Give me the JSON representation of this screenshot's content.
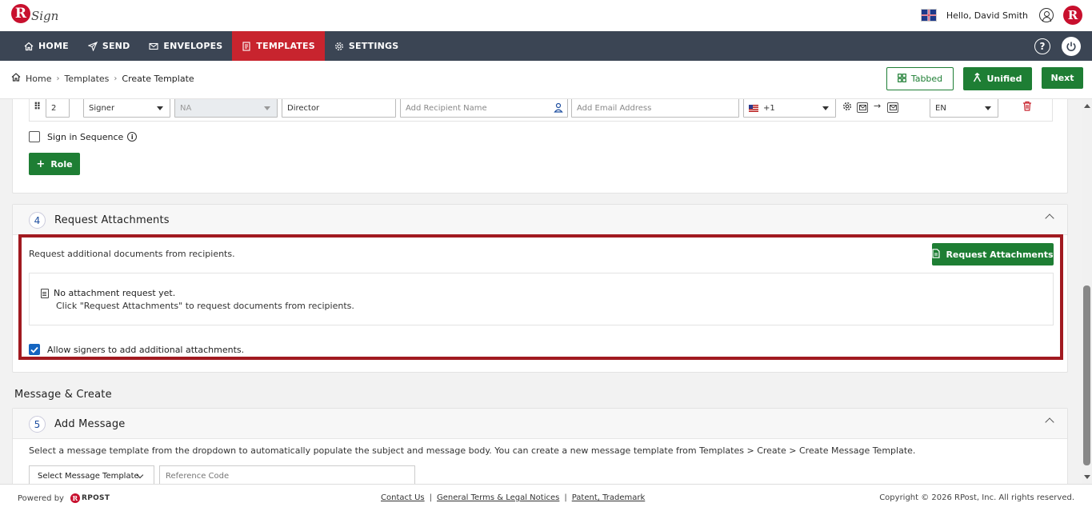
{
  "app": {
    "logo_letter": "R",
    "logo_text": "Sign",
    "greeting": "Hello, David Smith",
    "brand_letter": "R"
  },
  "nav": {
    "items": [
      {
        "label": "HOME",
        "icon": "home-icon"
      },
      {
        "label": "SEND",
        "icon": "send-icon"
      },
      {
        "label": "ENVELOPES",
        "icon": "envelope-icon"
      },
      {
        "label": "TEMPLATES",
        "icon": "template-icon",
        "active": true
      },
      {
        "label": "SETTINGS",
        "icon": "gear-icon"
      }
    ],
    "help_label": "?"
  },
  "breadcrumb": {
    "items": [
      "Home",
      "Templates",
      "Create Template"
    ],
    "separator": "›"
  },
  "toolbar": {
    "tabbed_label": "Tabbed",
    "unified_label": "Unified",
    "next_label": "Next"
  },
  "recipient_row": {
    "order": "2",
    "role_type": "Signer",
    "delegate": "NA",
    "role_name": "Director",
    "recipient_name_placeholder": "Add Recipient Name",
    "email_placeholder": "Add Email Address",
    "country_code": "+1",
    "language": "EN"
  },
  "roles": {
    "sequence_label": "Sign in Sequence",
    "add_role_label": "Role",
    "add_symbol": "+"
  },
  "attachments": {
    "step": "4",
    "title": "Request Attachments",
    "description": "Request additional documents from recipients.",
    "button_label": "Request Attachments",
    "empty_title": "No attachment request yet.",
    "empty_hint": "Click \"Request Attachments\" to request documents from recipients.",
    "allow_label": "Allow signers to add additional attachments.",
    "allow_checked": true
  },
  "message_section": {
    "heading": "Message & Create",
    "step": "5",
    "title": "Add Message",
    "description": "Select a message template from the dropdown to automatically populate the subject and message body. You can create a new message template from Templates > Create > Create Message Template.",
    "select_label": "Select Message Template",
    "reference_placeholder": "Reference Code"
  },
  "footer": {
    "powered_by": "Powered by",
    "rpost_letter": "R",
    "rpost_text": "RPOST",
    "links": [
      "Contact Us",
      "General Terms & Legal Notices",
      "Patent, Trademark"
    ],
    "link_separator": "|",
    "copyright": "Copyright © 2026 RPost, Inc. All rights reserved."
  },
  "colors": {
    "nav_bg": "#3b4554",
    "nav_active": "#c8242e",
    "primary_green": "#1e7e34",
    "brand_red": "#c8102e",
    "highlight_border": "#a11a20",
    "checkbox_blue": "#1565c0"
  }
}
